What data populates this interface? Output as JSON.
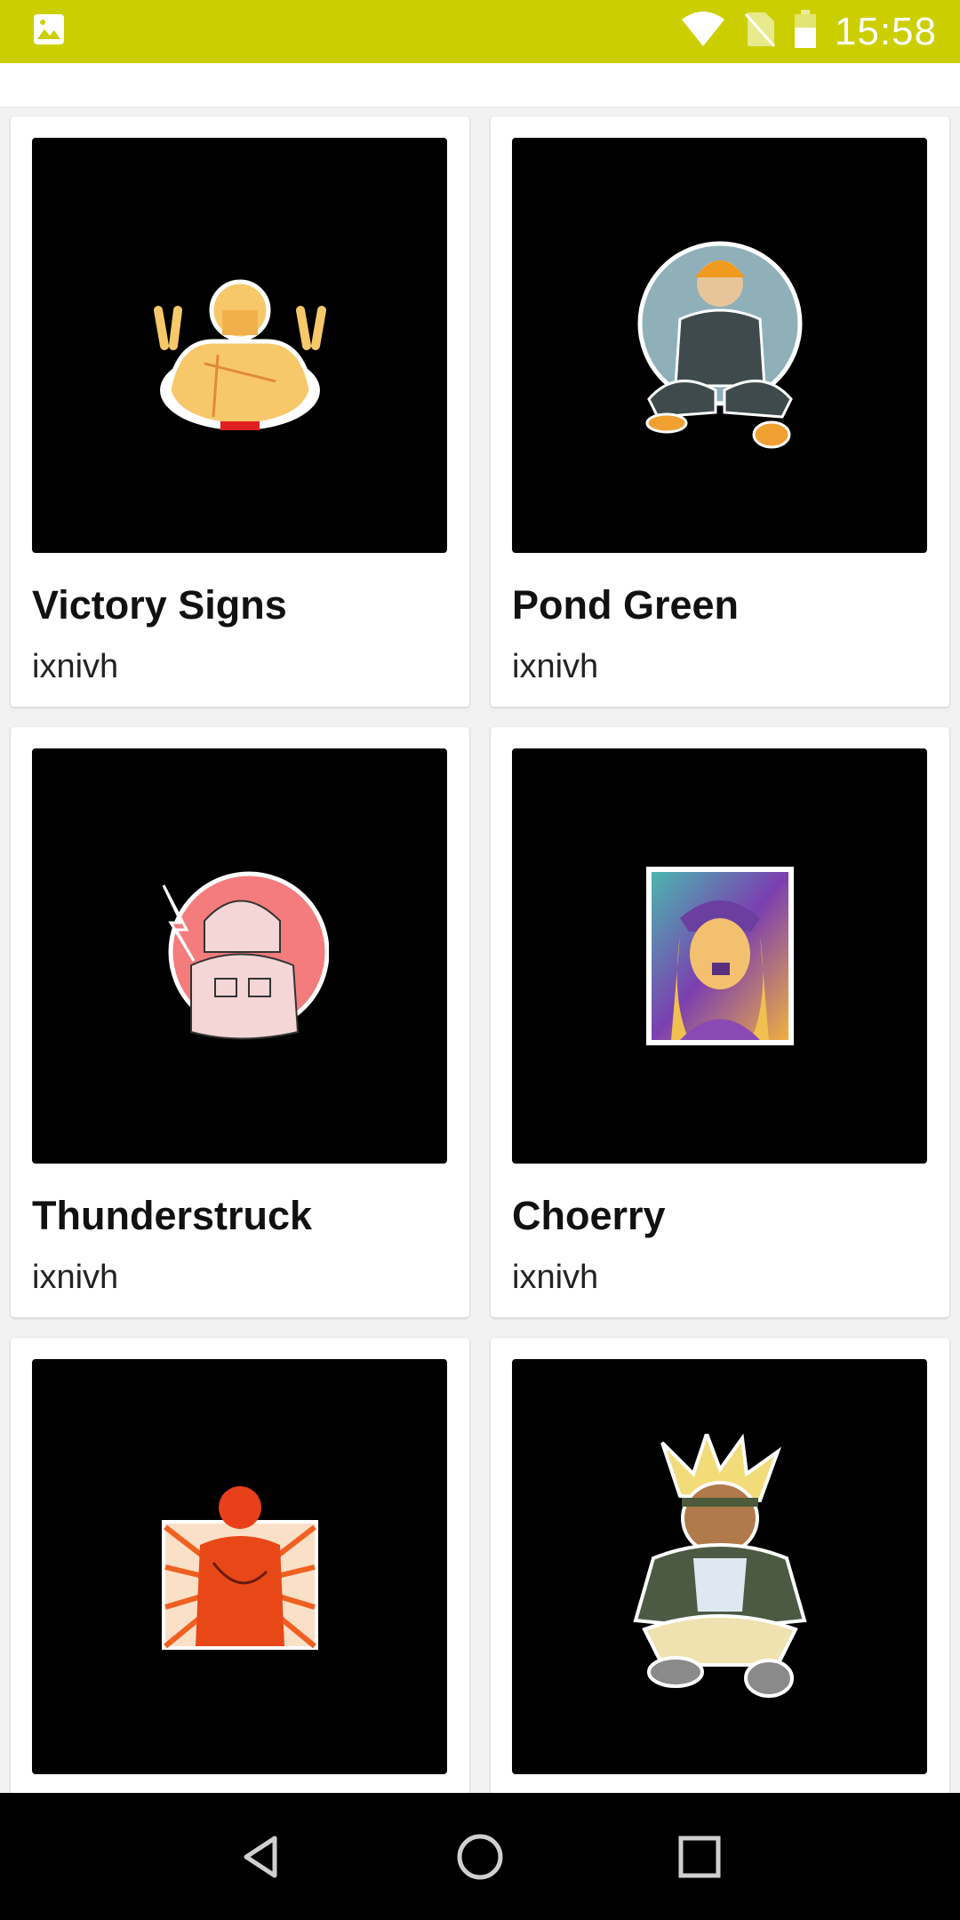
{
  "status_bar": {
    "time": "15:58",
    "left_icon": "image-icon",
    "right_icons": [
      "wifi-icon",
      "no-sim-icon",
      "battery-icon"
    ],
    "background_color": "#cbcf00"
  },
  "items": [
    {
      "title": "Victory Signs",
      "author": "ixnivh",
      "art": "yellow-character-sticker"
    },
    {
      "title": "Pond Green",
      "author": "ixnivh",
      "art": "blue-circle-character-sticker"
    },
    {
      "title": "Thunderstruck",
      "author": "ixnivh",
      "art": "pink-circle-character-sticker"
    },
    {
      "title": "Choerry",
      "author": "ixnivh",
      "art": "purple-yellow-card-sticker"
    },
    {
      "title": "",
      "author": "",
      "art": "orange-sunburst-sticker"
    },
    {
      "title": "",
      "author": "",
      "art": "spiky-hair-character-sticker"
    }
  ],
  "nav_bar": {
    "buttons": [
      "back-icon",
      "home-icon",
      "recents-icon"
    ]
  }
}
